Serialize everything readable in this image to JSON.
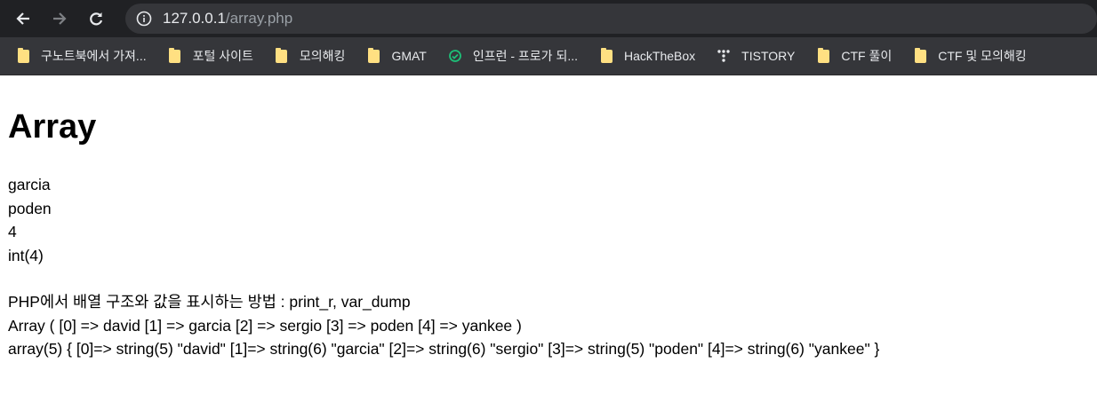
{
  "browser": {
    "url_host": "127.0.0.1",
    "url_path": "/array.php"
  },
  "bookmarks": [
    {
      "label": "구노트북에서 가져...",
      "icon": "folder-icon"
    },
    {
      "label": "포털 사이트",
      "icon": "folder-icon"
    },
    {
      "label": "모의해킹",
      "icon": "folder-icon"
    },
    {
      "label": "GMAT",
      "icon": "folder-icon"
    },
    {
      "label": "인프런 - 프로가 되...",
      "icon": "inflearn-icon"
    },
    {
      "label": "HackTheBox",
      "icon": "folder-icon"
    },
    {
      "label": "TISTORY",
      "icon": "tistory-icon"
    },
    {
      "label": "CTF 풀이",
      "icon": "folder-icon"
    },
    {
      "label": "CTF 및 모의해킹",
      "icon": "folder-icon"
    }
  ],
  "page": {
    "title": "Array",
    "outputs": [
      "garcia",
      "poden",
      "4",
      "int(4)"
    ],
    "description": "PHP에서 배열 구조와 값을 표시하는 방법 : print_r, var_dump",
    "print_r": "Array ( [0] => david [1] => garcia [2] => sergio [3] => poden [4] => yankee )",
    "var_dump": "array(5) { [0]=> string(5) \"david\" [1]=> string(6) \"garcia\" [2]=> string(6) \"sergio\" [3]=> string(5) \"poden\" [4]=> string(6) \"yankee\" }"
  }
}
